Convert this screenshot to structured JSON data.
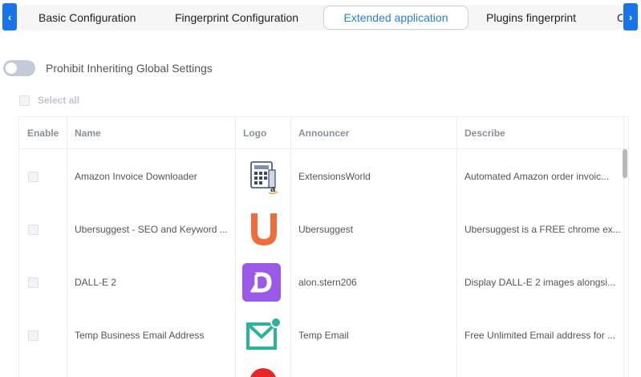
{
  "tabs": [
    {
      "label": "Basic Configuration",
      "active": false
    },
    {
      "label": "Fingerprint Configuration",
      "active": false
    },
    {
      "label": "Extended application",
      "active": true
    },
    {
      "label": "Plugins fingerprint",
      "active": false
    },
    {
      "label": "C",
      "active": false
    }
  ],
  "toggle": {
    "label": "Prohibit Inheriting Global Settings",
    "on": false
  },
  "select_all": {
    "label": "Select all"
  },
  "table": {
    "headers": [
      "Enable",
      "Name",
      "Logo",
      "Announcer",
      "Describe"
    ],
    "rows": [
      {
        "name": "Amazon Invoice Downloader",
        "logo": "invoice-calculator-icon",
        "announcer": "ExtensionsWorld",
        "describe": "Automated Amazon order invoic..."
      },
      {
        "name": "Ubersuggest - SEO and Keyword ...",
        "logo": "ubersuggest-u-icon",
        "announcer": "Ubersuggest",
        "describe": "Ubersuggest is a FREE chrome ex..."
      },
      {
        "name": "DALL-E 2",
        "logo": "dalle-d-icon",
        "announcer": "alon.stern206",
        "describe": "Display DALL-E 2 images alongsi..."
      },
      {
        "name": "Temp Business Email Address",
        "logo": "mail-envelope-icon",
        "announcer": "Temp Email",
        "describe": "Free Unlimited Email address for ..."
      }
    ]
  },
  "colors": {
    "accent": "#1a73e8",
    "active_tab_text": "#2a7fd4",
    "ubersuggest": "#f26b3a",
    "dalle": "#9b59e8",
    "mail": "#2ab39b"
  }
}
